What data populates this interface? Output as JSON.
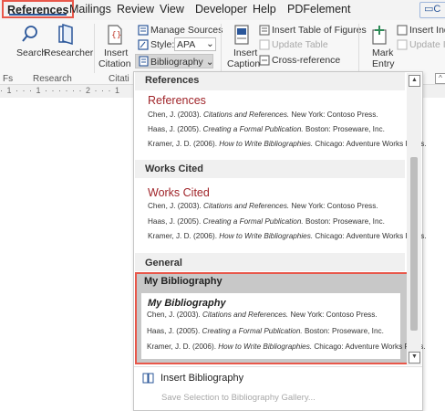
{
  "tabs": [
    "References",
    "Mailings",
    "Review",
    "View",
    "Developer",
    "Help",
    "PDFelement"
  ],
  "share_label": "C",
  "ribbon": {
    "search": "Search",
    "researcher": "Researcher",
    "insert_citation_l1": "Insert",
    "insert_citation_l2": "Citation ⌄",
    "manage_sources": "Manage Sources",
    "style_label": "Style:",
    "style_value": "APA",
    "bibliography": "Bibliography ⌄",
    "insert_caption_l1": "Insert",
    "insert_caption_l2": "Caption",
    "insert_table_of_figures": "Insert Table of Figures",
    "update_table": "Update Table",
    "cross_reference": "Cross-reference",
    "mark_entry_l1": "Mark",
    "mark_entry_l2": "Entry",
    "insert_index": "Insert Ind",
    "update_index": "Update In",
    "group_research": "Research",
    "group_citations": "Citati",
    "group_fs": "Fs"
  },
  "ruler_text": "· 1 · · · 1 · · · · · · 2 · · · 1",
  "dropdown": {
    "section_references": "References",
    "section_works_cited": "Works Cited",
    "section_general": "General",
    "item1": {
      "title": "References",
      "refs": [
        {
          "author": "Chen, J. (2003). ",
          "work": "Citations and References.",
          "pub": " New York: Contoso Press."
        },
        {
          "author": "Haas, J. (2005). ",
          "work": "Creating a Formal Publication.",
          "pub": " Boston: Proseware, Inc."
        },
        {
          "author": "Kramer, J. D. (2006). ",
          "work": "How to Write Bibliographies.",
          "pub": " Chicago: Adventure Works Press."
        }
      ]
    },
    "item2": {
      "title": "Works Cited",
      "refs": [
        {
          "author": "Chen, J. (2003). ",
          "work": "Citations and References.",
          "pub": " New York: Contoso Press."
        },
        {
          "author": "Haas, J. (2005). ",
          "work": "Creating a Formal Publication.",
          "pub": " Boston: Proseware, Inc."
        },
        {
          "author": "Kramer, J. D. (2006). ",
          "work": "How to Write Bibliographies.",
          "pub": " Chicago: Adventure Works Press."
        }
      ]
    },
    "item3": {
      "header": "My Bibliography",
      "title": "My Bibliography",
      "refs": [
        {
          "author": "Chen, J. (2003). ",
          "work": "Citations and References.",
          "pub": " New York: Contoso Press."
        },
        {
          "author": "Haas, J. (2005). ",
          "work": "Creating a Formal Publication.",
          "pub": " Boston: Proseware, Inc."
        },
        {
          "author": "Kramer, J. D. (2006). ",
          "work": "How to Write Bibliographies.",
          "pub": " Chicago: Adventure Works Press."
        }
      ]
    },
    "insert_bibliography": "Insert Bibliography",
    "save_selection": "Save Selection to Bibliography Gallery..."
  },
  "colors": {
    "accent": "#2b579a",
    "highlight": "#e8574a",
    "title_red": "#a0252a"
  }
}
